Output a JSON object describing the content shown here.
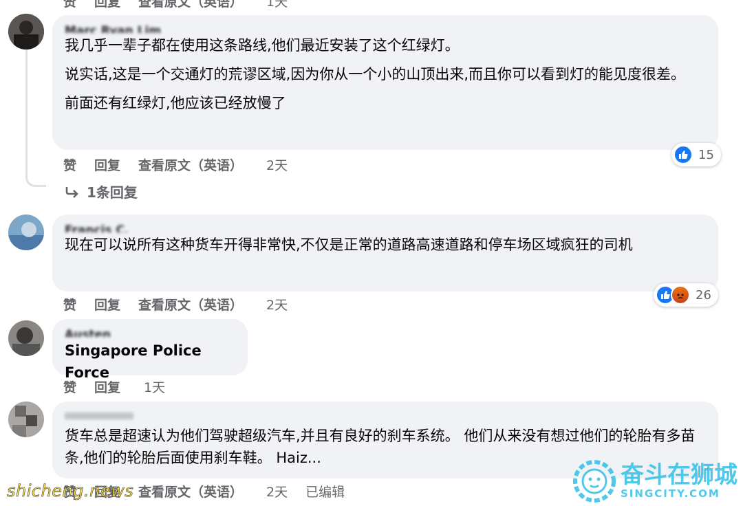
{
  "top_actions": {
    "like": "赞",
    "reply": "回复",
    "translate": "查看原文（英语）",
    "time": "1天"
  },
  "comments": [
    {
      "name": "Marc Ryan Lim",
      "paragraphs": [
        "我几乎一辈子都在使用这条路线,他们最近安装了这个红绿灯。",
        "说实话,这是一个交通灯的荒谬区域,因为你从一个小的山顶出来,而且你可以看到灯的能见度很差。",
        "前面还有红绿灯,他应该已经放慢了"
      ],
      "like": "赞",
      "reply": "回复",
      "translate": "查看原文（英语）",
      "time": "2天",
      "reaction_count": "15",
      "replies_link": "1条回复"
    },
    {
      "name": "Francis C.",
      "paragraphs": [
        "现在可以说所有这种货车开得非常快,不仅是正常的道路高速道路和停车场区域疯狂的司机"
      ],
      "like": "赞",
      "reply": "回复",
      "translate": "查看原文（英语）",
      "time": "2天",
      "reaction_count": "26"
    },
    {
      "name": "Austen",
      "paragraphs": [
        "Singapore Police Force"
      ],
      "like": "赞",
      "reply": "回复",
      "time": "1天"
    },
    {
      "name": "",
      "paragraphs": [
        "货车总是超速认为他们驾驶超级汽车,并且有良好的刹车系统。 他们从来没有想过他们的轮胎有多苗条,他们的轮胎后面使用刹车鞋。 Haiz..."
      ],
      "like": "赞",
      "reply": "回复",
      "translate": "查看原文（英语）",
      "time": "2天",
      "edited": "已编辑"
    }
  ],
  "watermarks": {
    "left": "shicheng.news",
    "right_brand": "奋斗在狮城",
    "right_sub": "SINGCITY.COM"
  },
  "colors": {
    "bubble": "#f0f2f5",
    "meta": "#65676b",
    "like_blue": "#1877f2",
    "brand_cyan": "#3cc3e8"
  }
}
